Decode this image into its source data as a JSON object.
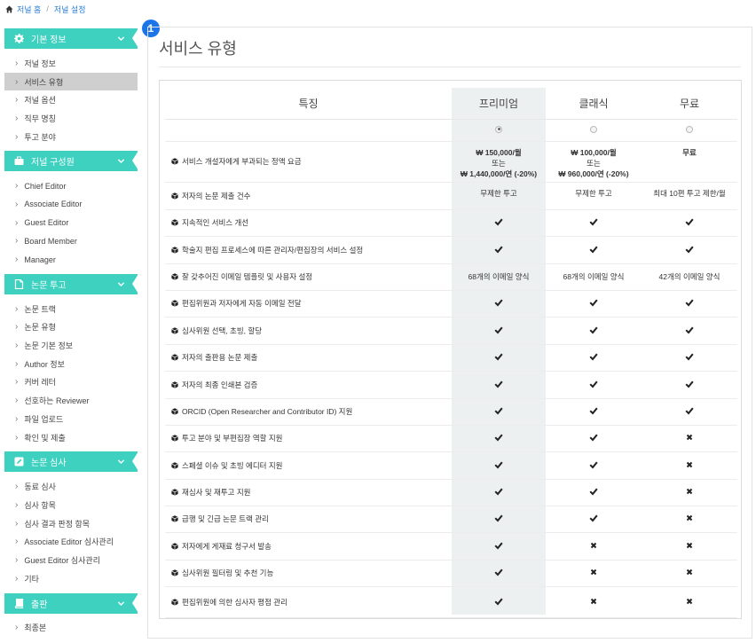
{
  "breadcrumb": {
    "home": "저널 홈",
    "separator": "/",
    "current": "저널 설정"
  },
  "step_badge": "1",
  "sidebar": {
    "sections": [
      {
        "title": "기본 정보",
        "icon": "gear-icon",
        "items": [
          "저널 정보",
          "서비스 유형",
          "저널 옵션",
          "직무 명칭",
          "투고 분야"
        ]
      },
      {
        "title": "저널 구성원",
        "icon": "briefcase-icon",
        "items": [
          "Chief Editor",
          "Associate Editor",
          "Guest Editor",
          "Board Member",
          "Manager"
        ]
      },
      {
        "title": "논문 투고",
        "icon": "document-icon",
        "items": [
          "논문 트랙",
          "논문 유형",
          "논문 기본 정보",
          "Author 정보",
          "커버 레터",
          "선호하는 Reviewer",
          "파일 업로드",
          "확인 및 제출"
        ]
      },
      {
        "title": "논문 심사",
        "icon": "edit-icon",
        "items": [
          "동료 심사",
          "심사 항목",
          "심사 결과 판정 항목",
          "Associate Editor 심사관리",
          "Guest Editor 심사관리",
          "기타"
        ]
      },
      {
        "title": "출판",
        "icon": "book-icon",
        "items": [
          "최종본"
        ]
      }
    ],
    "active_item": "서비스 유형"
  },
  "page": {
    "title": "서비스 유형"
  },
  "plans_table": {
    "headers": [
      "특징",
      "프리미엄",
      "클래식",
      "무료"
    ],
    "selected_plan": "프리미엄",
    "rows": [
      {
        "feature": "서비스 개설자에게 부과되는 정액 요금",
        "values": [
          [
            "₩ 150,000/월",
            "또는",
            "₩ 1,440,000/연 (-20%)"
          ],
          [
            "₩ 100,000/월",
            "또는",
            "₩ 960,000/연 (-20%)"
          ],
          [
            "무료"
          ]
        ]
      },
      {
        "feature": "저자의 논문 제출 건수",
        "values": [
          "무제한 투고",
          "무제한 투고",
          "최대 10편 투고 제한/월"
        ]
      },
      {
        "feature": "지속적인 서비스 개선",
        "values": [
          "check",
          "check",
          "check"
        ]
      },
      {
        "feature": "학술지 편집 프로세스에 따른 관리자/편집장의 서비스 설정",
        "values": [
          "check",
          "check",
          "check"
        ]
      },
      {
        "feature": "잘 갖추어진 이메일 템플릿 및 사용자 설정",
        "values": [
          "68개의 이메일 양식",
          "68개의 이메일 양식",
          "42개의 이메일 양식"
        ]
      },
      {
        "feature": "편집위원과 저자에게 자동 이메일 전달",
        "values": [
          "check",
          "check",
          "check"
        ]
      },
      {
        "feature": "심사위원 선택, 초빙, 할당",
        "values": [
          "check",
          "check",
          "check"
        ]
      },
      {
        "feature": "저자의 출판용 논문 제출",
        "values": [
          "check",
          "check",
          "check"
        ]
      },
      {
        "feature": "저자의 최종 인쇄본 검증",
        "values": [
          "check",
          "check",
          "check"
        ]
      },
      {
        "feature": "ORCID (Open Researcher and Contributor ID) 지원",
        "values": [
          "check",
          "check",
          "check"
        ]
      },
      {
        "feature": "투고 분야 및 부편집장 역할 지원",
        "values": [
          "check",
          "check",
          "cross"
        ]
      },
      {
        "feature": "스페셜 이슈 및 초빙 에디터 지원",
        "values": [
          "check",
          "check",
          "cross"
        ]
      },
      {
        "feature": "재심사 및 재투고 지원",
        "values": [
          "check",
          "check",
          "cross"
        ]
      },
      {
        "feature": "급행 및 긴급 논문 트랙 관리",
        "values": [
          "check",
          "check",
          "cross"
        ]
      },
      {
        "feature": "저자에게 게재료 청구서 발송",
        "values": [
          "check",
          "cross",
          "cross"
        ]
      },
      {
        "feature": "심사위원 필터링 및 추천 기능",
        "values": [
          "check",
          "cross",
          "cross"
        ]
      },
      {
        "feature": "편집위원에 의한 심사자 평점 관리",
        "values": [
          "check",
          "cross",
          "cross"
        ]
      }
    ]
  },
  "colors": {
    "accent": "#3fd1c0",
    "link": "#2a7fd4",
    "badge": "#1b74e8",
    "premium_column": "#ecf0f1",
    "active_item": "#cfcfcf"
  }
}
